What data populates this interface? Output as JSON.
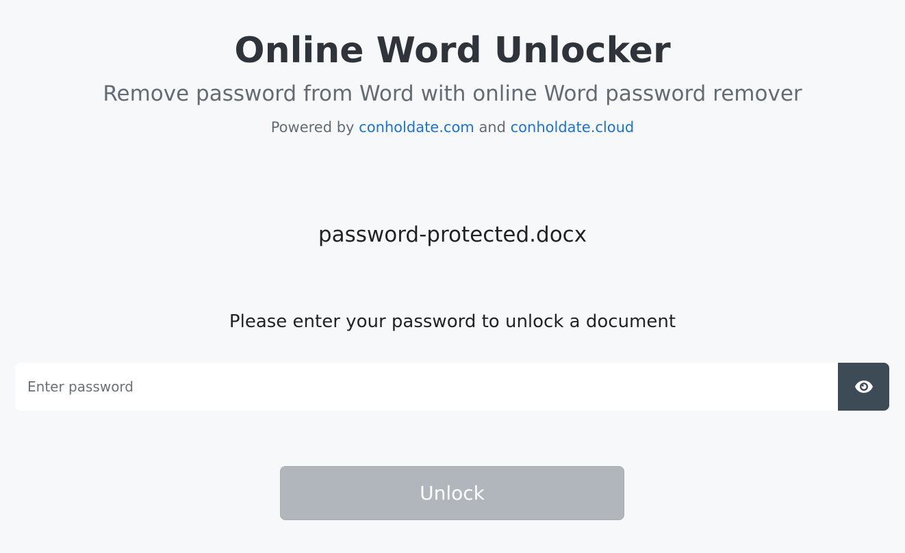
{
  "header": {
    "title": "Online Word Unlocker",
    "subtitle": "Remove password from Word with online Word password remover",
    "powered_prefix": "Powered by",
    "link1": "conholdate.com",
    "and": "and",
    "link2": "conholdate.cloud"
  },
  "file": {
    "name": "password-protected.docx"
  },
  "form": {
    "prompt": "Please enter your password to unlock a document",
    "password_placeholder": "Enter password",
    "password_value": "",
    "toggle_icon": "eye-icon",
    "unlock_label": "Unlock"
  },
  "colors": {
    "background": "#f7f8fa",
    "link": "#1a73d9",
    "toggle_button": "#3d4b57",
    "unlock_button_disabled": "#b1b6bc"
  }
}
